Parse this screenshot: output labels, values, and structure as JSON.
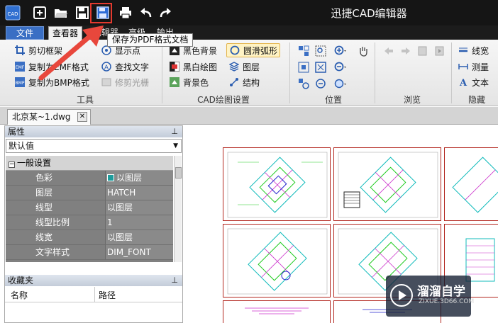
{
  "app": {
    "title": "迅捷CAD编辑器",
    "logo_text": "CAD"
  },
  "quick_access": [
    {
      "name": "new",
      "icon": "new-file-icon"
    },
    {
      "name": "open",
      "icon": "open-folder-icon"
    },
    {
      "name": "save",
      "icon": "save-icon"
    },
    {
      "name": "save_pdf",
      "icon": "save-as-pdf-icon"
    },
    {
      "name": "print",
      "icon": "print-icon"
    },
    {
      "name": "undo",
      "icon": "undo-icon"
    },
    {
      "name": "redo",
      "icon": "redo-icon"
    }
  ],
  "menu": {
    "file": "文件",
    "viewer": "查看器",
    "edit": "编辑器",
    "advanced": "高级",
    "output": "输出"
  },
  "tooltip": "保存为PDF格式文档",
  "ribbon": {
    "tools": {
      "label": "工具",
      "items": [
        "剪切框架",
        "复制为EMF格式",
        "复制为BMP格式",
        "显示点",
        "查找文字",
        "修剪光栅"
      ]
    },
    "cad_settings": {
      "label": "CAD绘图设置",
      "items": [
        "黑色背景",
        "黑白绘图",
        "背景色",
        "圆滑弧形",
        "图层",
        "结构"
      ]
    },
    "position": {
      "label": "位置"
    },
    "browse": {
      "label": "浏览"
    },
    "hide": {
      "label": "隐藏",
      "items": [
        "线宽",
        "测量",
        "文本"
      ]
    }
  },
  "document_tab": "北京某~1.dwg",
  "properties": {
    "header": "属性",
    "dropdown": "默认值",
    "category": "一般设置",
    "rows": [
      {
        "name": "色彩",
        "value": "以图层"
      },
      {
        "name": "图层",
        "value": "HATCH"
      },
      {
        "name": "线型",
        "value": "以图层"
      },
      {
        "name": "线型比例",
        "value": "1"
      },
      {
        "name": "线宽",
        "value": "以图层"
      },
      {
        "name": "文字样式",
        "value": "DIM_FONT"
      }
    ]
  },
  "favorites": {
    "header": "收藏夹",
    "col_name": "名称",
    "col_path": "路径"
  },
  "watermark": {
    "brand": "溜溜自学",
    "url": "ZIXUE.3D66.COM"
  },
  "colors": {
    "accent": "#3a6fc4",
    "highlight_box": "#e43a2f",
    "drawing_frame": "#b3271f"
  }
}
